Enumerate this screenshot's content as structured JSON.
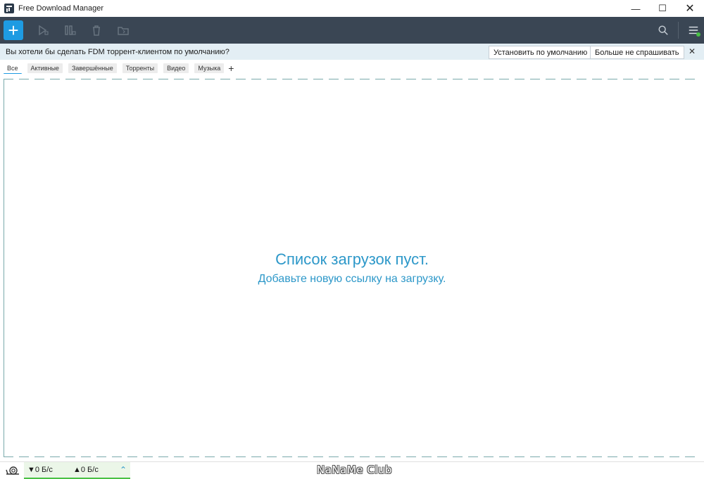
{
  "window": {
    "title": "Free Download Manager",
    "minimize": "—",
    "maximize": "☐",
    "close": "✕"
  },
  "toolbar": {
    "add_label": "+",
    "icons": [
      "play-icon",
      "pause-icon",
      "trash-icon",
      "folder-icon",
      "search-icon",
      "menu-icon"
    ]
  },
  "notification": {
    "text": "Вы хотели бы сделать FDM торрент-клиентом по умолчанию?",
    "set_default": "Установить по умолчанию",
    "dont_ask": "Больше не спрашивать",
    "close": "✕"
  },
  "tabs": {
    "items": [
      {
        "label": "Все",
        "active": true
      },
      {
        "label": "Активные",
        "active": false
      },
      {
        "label": "Завершённые",
        "active": false
      },
      {
        "label": "Торренты",
        "active": false
      },
      {
        "label": "Видео",
        "active": false
      },
      {
        "label": "Музыка",
        "active": false
      }
    ],
    "add": "+"
  },
  "main": {
    "empty_title": "Список загрузок пуст.",
    "empty_subtitle": "Добавьте новую ссылку на загрузку."
  },
  "status": {
    "down_speed": "▼0 Б/с",
    "up_speed": "▲0 Б/с",
    "chevron": "⌃",
    "watermark": "NaNaMe Club"
  },
  "colors": {
    "toolbar_bg": "#3a4654",
    "accent": "#1e9be2",
    "notify_bg": "#e3eef4",
    "empty_text": "#2d98c9",
    "speed_ok": "#49c144"
  }
}
